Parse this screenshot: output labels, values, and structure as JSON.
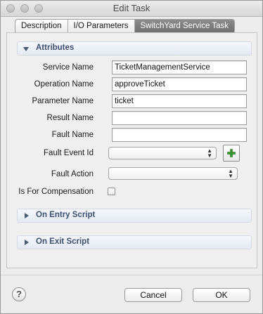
{
  "window": {
    "title": "Edit Task"
  },
  "tabs": [
    {
      "label": "Description",
      "active": false
    },
    {
      "label": "I/O Parameters",
      "active": false
    },
    {
      "label": "SwitchYard Service Task",
      "active": true
    }
  ],
  "attributes": {
    "header": "Attributes",
    "service_name": {
      "label": "Service Name",
      "value": "TicketManagementService"
    },
    "operation_name": {
      "label": "Operation Name",
      "value": "approveTicket"
    },
    "parameter_name": {
      "label": "Parameter Name",
      "value": "ticket"
    },
    "result_name": {
      "label": "Result Name",
      "value": ""
    },
    "fault_name": {
      "label": "Fault Name",
      "value": ""
    },
    "fault_event_id": {
      "label": "Fault Event Id",
      "value": ""
    },
    "fault_action": {
      "label": "Fault Action",
      "value": ""
    },
    "is_for_compensation": {
      "label": "Is For Compensation",
      "checked": false
    }
  },
  "sections": {
    "on_entry": "On Entry Script",
    "on_exit": "On Exit Script"
  },
  "buttons": {
    "help": "?",
    "cancel": "Cancel",
    "ok": "OK"
  },
  "colors": {
    "active_tab": "#7a7a7a",
    "section_header_text": "#3e5070",
    "add_icon": "#3b9a2f"
  },
  "icons": {
    "add": "plus-icon",
    "help": "help-icon"
  }
}
